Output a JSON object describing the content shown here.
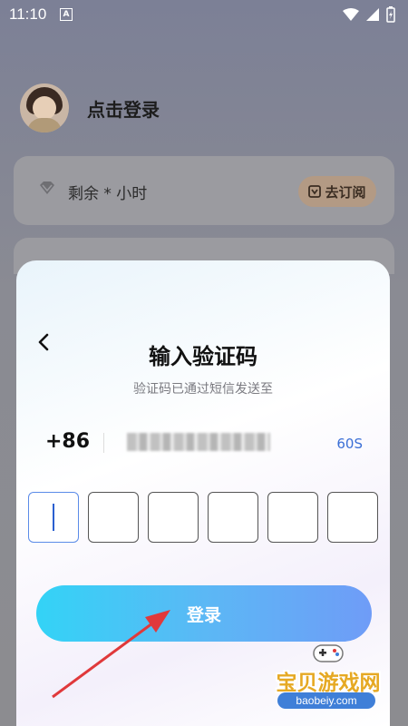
{
  "status_bar": {
    "time": "11:10",
    "notif_icon": "A"
  },
  "profile": {
    "login_prompt": "点击登录"
  },
  "subscription": {
    "remaining": "剩余 * 小时",
    "subscribe_button": "去订阅"
  },
  "modal": {
    "title": "输入验证码",
    "subtitle": "验证码已通过短信发送至",
    "country_code": "+86",
    "countdown": "60S",
    "code_boxes": [
      "",
      "",
      "",
      "",
      "",
      ""
    ],
    "login_button": "登录"
  },
  "watermark": {
    "brand": "宝贝游戏网",
    "url": "baobeiy.com"
  },
  "colors": {
    "accent": "#3b6fd6",
    "button_gradient_start": "#33d3f6",
    "button_gradient_end": "#6f9cf7",
    "arrow": "#e0393b"
  }
}
